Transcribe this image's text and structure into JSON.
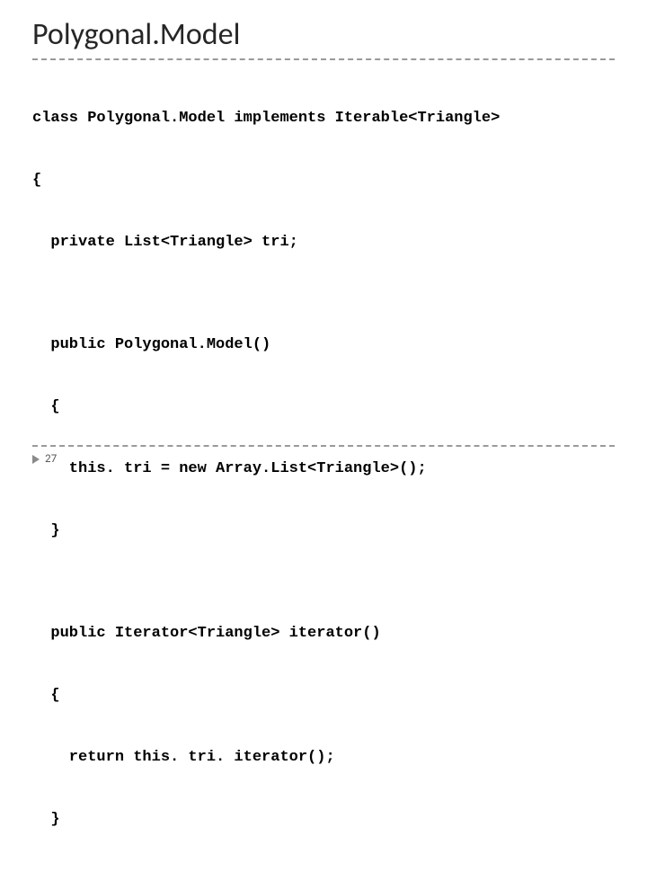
{
  "slide": {
    "title": "Polygonal.Model",
    "page_number": "27",
    "code_lines": [
      "class Polygonal.Model implements Iterable<Triangle>",
      "{",
      "  private List<Triangle> tri;",
      "",
      "  public Polygonal.Model()",
      "  {",
      "    this. tri = new Array.List<Triangle>();",
      "  }",
      "",
      "  public Iterator<Triangle> iterator()",
      "  {",
      "    return this. tri. iterator();",
      "  }"
    ]
  }
}
